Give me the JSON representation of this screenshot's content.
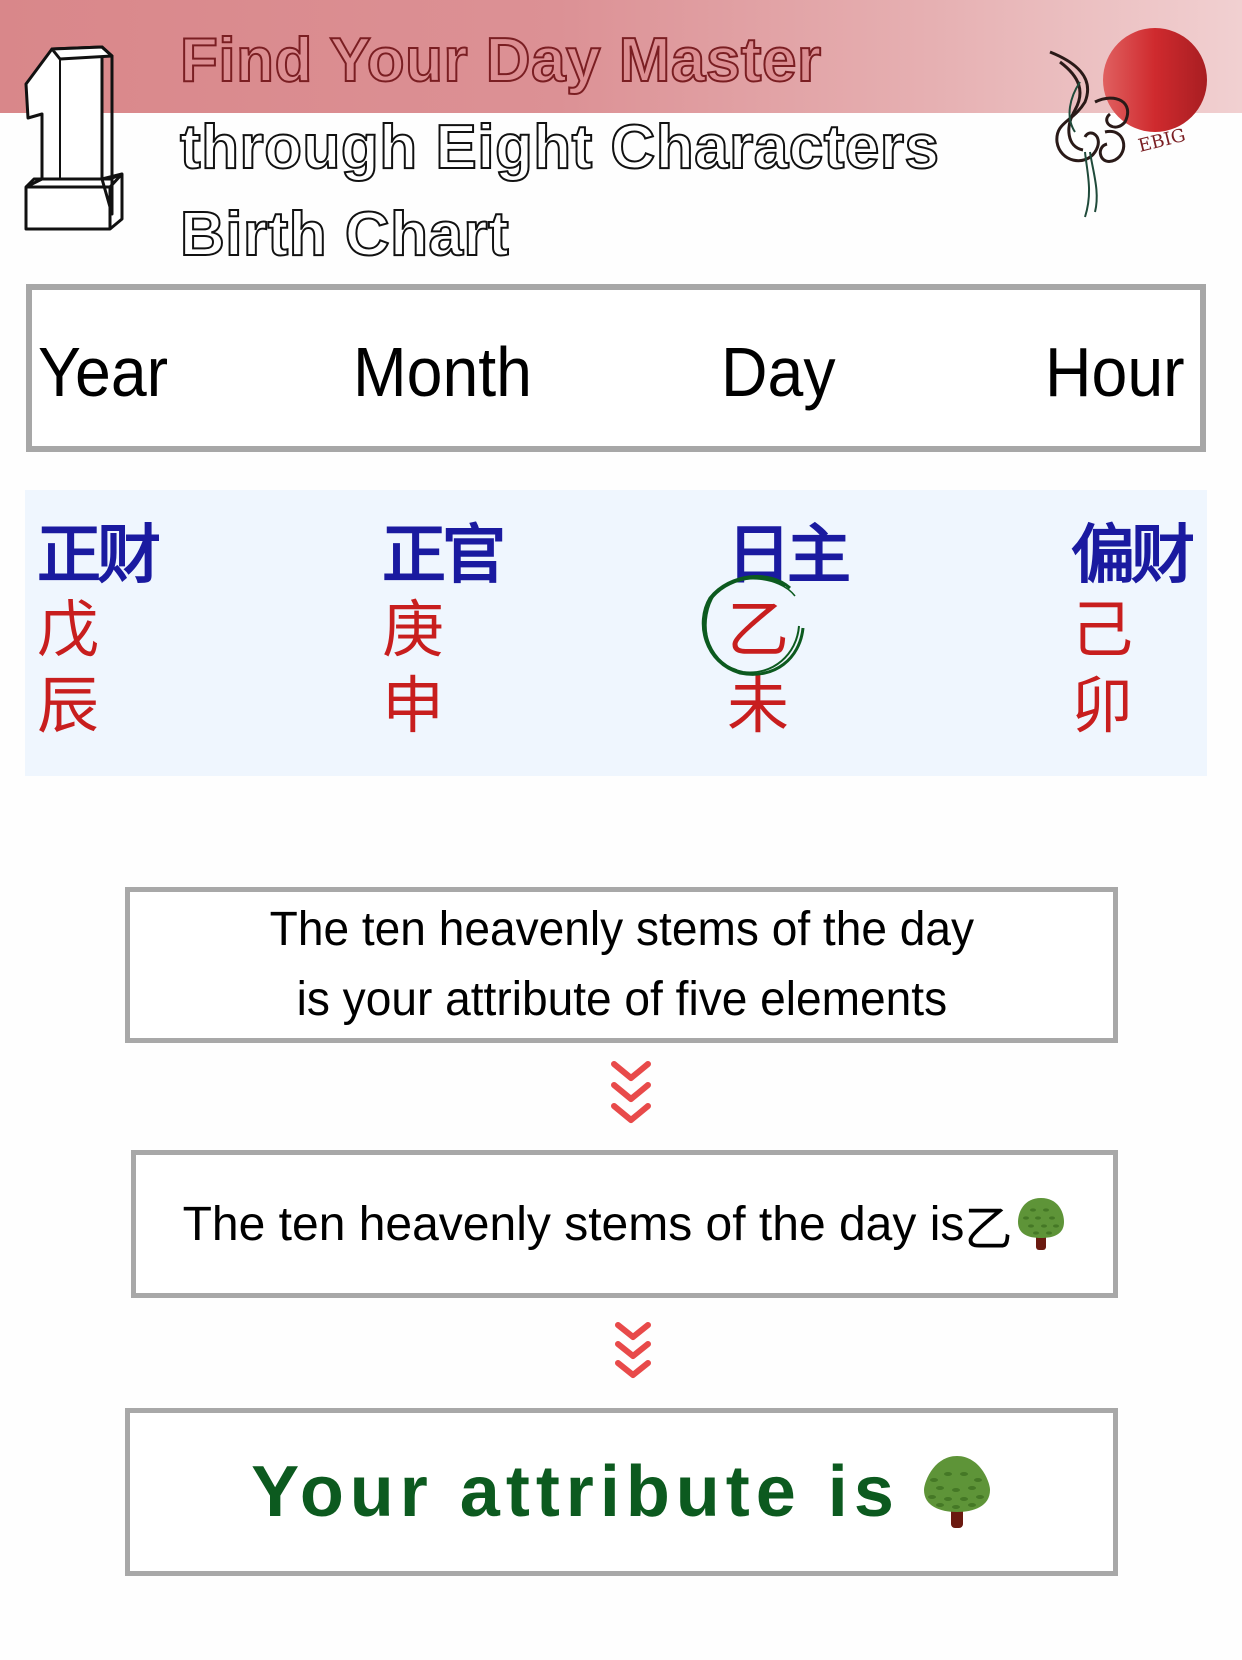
{
  "header": {
    "step_number": "1",
    "title_lines": [
      "Find Your Day Master",
      "through Eight Characters",
      "Birth Chart"
    ],
    "logo_text": "EBIG",
    "band_color": "#d9878a"
  },
  "pillars": {
    "labels": [
      "Year",
      "Month",
      "Day",
      "Hour"
    ]
  },
  "birth_chart": {
    "columns": [
      {
        "ten_god": "正财",
        "stem": "戊",
        "branch": "辰"
      },
      {
        "ten_god": "正官",
        "stem": "庚",
        "branch": "申"
      },
      {
        "ten_god": "日主",
        "stem": "乙",
        "branch": "未",
        "highlighted": true
      },
      {
        "ten_god": "偏财",
        "stem": "己",
        "branch": "卯"
      }
    ],
    "colors": {
      "ten_god": "#1a1aa0",
      "pillar": "#c81e1e",
      "highlight": "#0c5a1f"
    }
  },
  "flow": {
    "step1_lines": [
      "The ten heavenly stems of the day",
      "is your attribute of five elements"
    ],
    "step2_text": "The ten heavenly stems of the day is",
    "step2_stem": "乙",
    "step2_icon": "tree-icon",
    "step3_text": "Your attribute is",
    "step3_icon": "tree-icon",
    "arrow_color": "#e84a4a"
  }
}
